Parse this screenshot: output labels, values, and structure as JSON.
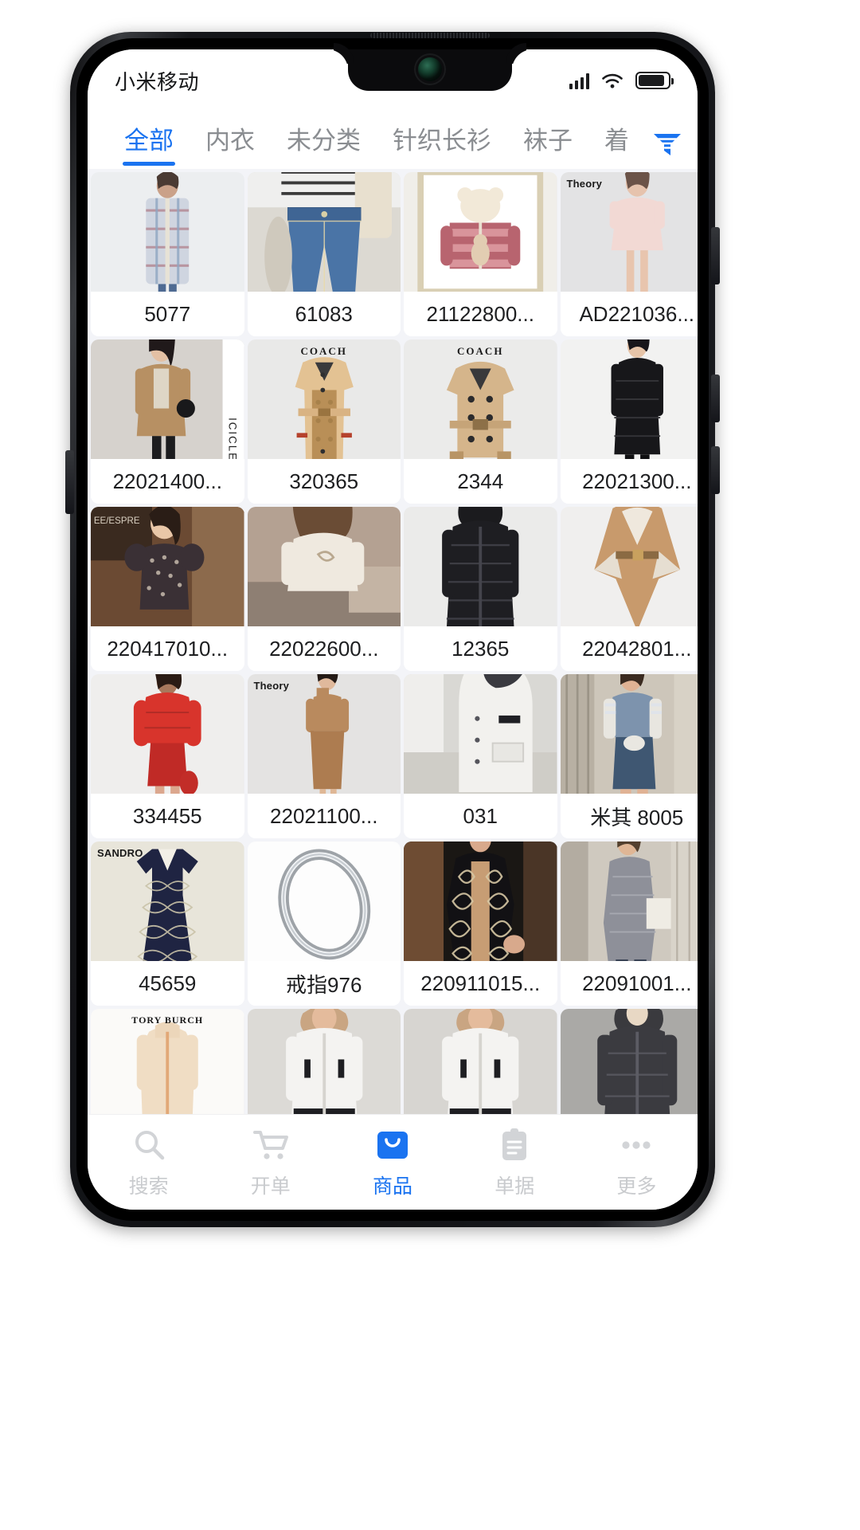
{
  "statusbar": {
    "carrier": "小米移动",
    "icons": [
      "signal-icon",
      "wifi-icon",
      "battery-icon"
    ],
    "battery_level": 80
  },
  "theme": {
    "accent": "#1a73f0",
    "inactive_text": "#8a8d91",
    "page_bg": "#f3f4f8",
    "card_bg": "#ffffff"
  },
  "category_tabs": {
    "active_index": 0,
    "items": [
      {
        "label": "全部"
      },
      {
        "label": "内衣"
      },
      {
        "label": "未分类"
      },
      {
        "label": "针织长衫"
      },
      {
        "label": "袜子"
      },
      {
        "label": "着"
      }
    ],
    "filter_icon": "filter-funnel-icon"
  },
  "products": [
    {
      "code": "5077",
      "brand": "",
      "kind": "plaid-shirt-dress"
    },
    {
      "code": "61083",
      "brand": "",
      "kind": "denim-shorts"
    },
    {
      "code": "21122800...",
      "brand": "",
      "kind": "kids-pink-jacket"
    },
    {
      "code": "AD221036...",
      "brand": "Theory",
      "kind": "pink-dress"
    },
    {
      "code": "22021400...",
      "brand": "",
      "kind": "camel-trench-model"
    },
    {
      "code": "320365",
      "brand": "COACH",
      "kind": "coach-long-trench"
    },
    {
      "code": "2344",
      "brand": "COACH",
      "kind": "coach-short-trench"
    },
    {
      "code": "22021300...",
      "brand": "",
      "kind": "black-long-puffer"
    },
    {
      "code": "220417010...",
      "brand": "",
      "kind": "floral-puff-sleeve-top"
    },
    {
      "code": "22022600...",
      "brand": "",
      "kind": "cream-hoodie-back"
    },
    {
      "code": "12365",
      "brand": "",
      "kind": "black-hooded-puffer"
    },
    {
      "code": "22042801...",
      "brand": "",
      "kind": "camel-cape-belt"
    },
    {
      "code": "334455",
      "brand": "",
      "kind": "red-puffer-dress"
    },
    {
      "code": "22021100...",
      "brand": "Theory",
      "kind": "camel-knit-midi"
    },
    {
      "code": "031",
      "brand": "",
      "kind": "white-long-parka"
    },
    {
      "code": "米其 8005",
      "brand": "",
      "kind": "denim-jacket-model"
    },
    {
      "code": "45659",
      "brand": "SANDRO",
      "kind": "navy-print-dress"
    },
    {
      "code": "戒指976",
      "brand": "",
      "kind": "silver-ring"
    },
    {
      "code": "220911015...",
      "brand": "",
      "kind": "black-embroidered-jacket"
    },
    {
      "code": "22091001...",
      "brand": "",
      "kind": "grey-knit-cardigan"
    },
    {
      "code": "",
      "brand": "TORY BURCH",
      "kind": "beige-fleece-zip"
    },
    {
      "code": "",
      "brand": "",
      "kind": "white-fur-hood-parka"
    },
    {
      "code": "",
      "brand": "",
      "kind": "white-fur-hood-parka-2"
    },
    {
      "code": "",
      "brand": "",
      "kind": "dark-grey-puffer"
    }
  ],
  "bottom_nav": {
    "active_index": 2,
    "items": [
      {
        "label": "搜索",
        "icon": "search-icon"
      },
      {
        "label": "开单",
        "icon": "shopping-cart-icon"
      },
      {
        "label": "商品",
        "icon": "shopping-bag-icon"
      },
      {
        "label": "单据",
        "icon": "clipboard-icon"
      },
      {
        "label": "更多",
        "icon": "ellipsis-icon"
      }
    ]
  }
}
